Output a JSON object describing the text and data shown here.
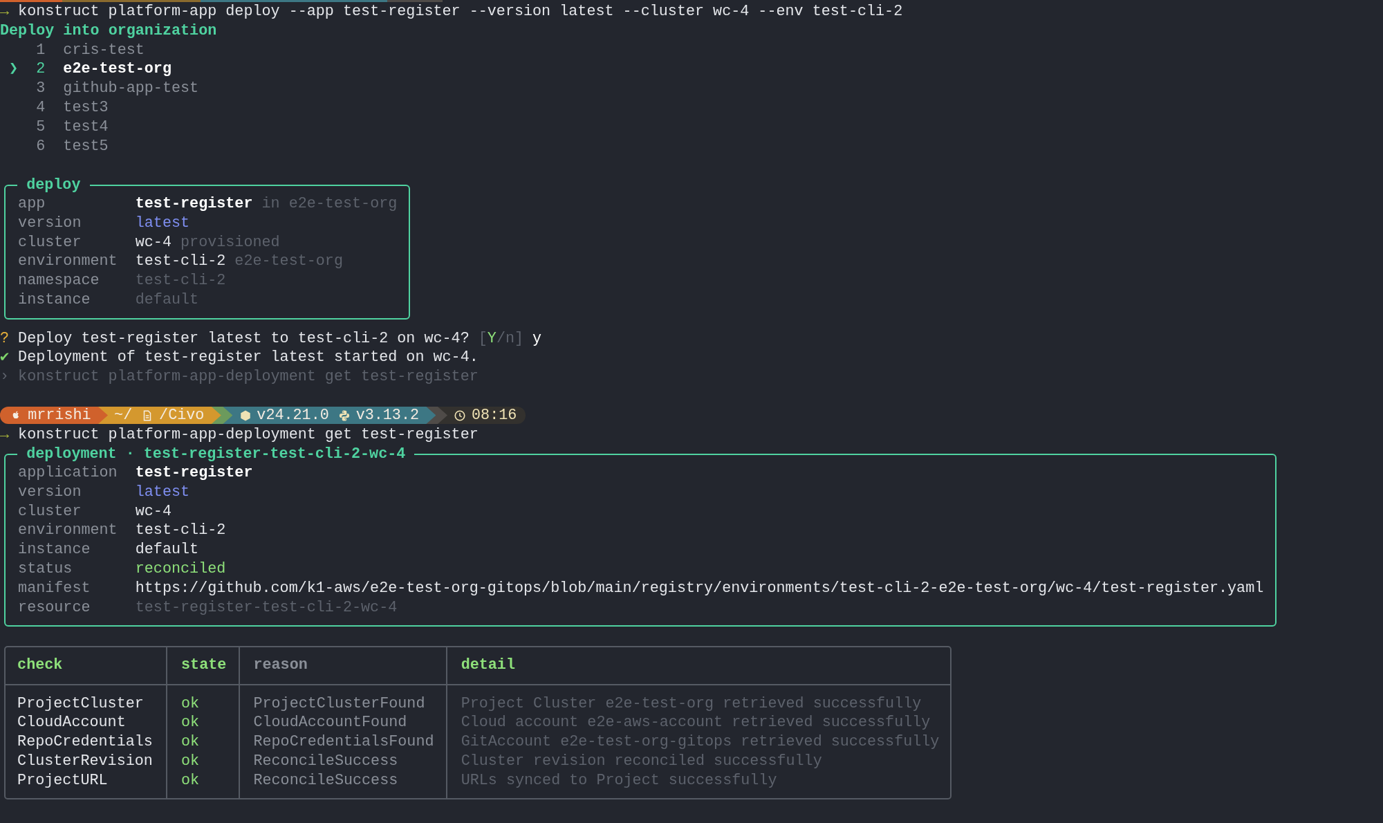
{
  "command_1": {
    "prompt_symbol": "→",
    "text": "konstruct platform-app deploy --app test-register --version latest --cluster wc-4 --env test-cli-2"
  },
  "org_picker": {
    "title": "Deploy into organization",
    "cursor": "❯",
    "options": [
      {
        "number": "1",
        "name": "cris-test",
        "selected": false
      },
      {
        "number": "2",
        "name": "e2e-test-org",
        "selected": true
      },
      {
        "number": "3",
        "name": "github-app-test",
        "selected": false
      },
      {
        "number": "4",
        "name": "test3",
        "selected": false
      },
      {
        "number": "5",
        "name": "test4",
        "selected": false
      },
      {
        "number": "6",
        "name": "test5",
        "selected": false
      }
    ]
  },
  "deploy_box": {
    "title": "deploy",
    "fields": [
      {
        "label": "app",
        "value": "test-register",
        "kind": "bold",
        "note": "in e2e-test-org"
      },
      {
        "label": "version",
        "value": "latest",
        "kind": "accent"
      },
      {
        "label": "cluster",
        "value": "wc-4",
        "kind": "plain",
        "note": "provisioned"
      },
      {
        "label": "environment",
        "value": "test-cli-2",
        "kind": "plain",
        "note": "e2e-test-org"
      },
      {
        "label": "namespace",
        "value": "test-cli-2",
        "kind": "muted"
      },
      {
        "label": "instance",
        "value": "default",
        "kind": "muted"
      }
    ]
  },
  "confirm": {
    "symbol": "?",
    "question": "Deploy test-register latest to test-cli-2 on wc-4?",
    "choices": {
      "open": "[",
      "default": "Y",
      "separator": "/",
      "other": "n",
      "close": "]"
    },
    "answer": "y"
  },
  "result": {
    "symbol": "✔",
    "text": "Deployment of test-register latest started on wc-4."
  },
  "suggestion": {
    "symbol": "›",
    "text": "konstruct platform-app-deployment get test-register"
  },
  "prompt_bar": {
    "segments": [
      {
        "color": "#d0612c",
        "items": [
          {
            "kind": "user",
            "text": "mrrishi"
          }
        ]
      },
      {
        "color": "#d4982e",
        "items": [
          {
            "kind": "home",
            "text": "~/"
          },
          {
            "kind": "folder",
            "text": "/Civo"
          }
        ]
      },
      {
        "color": "#6c9a5c"
      },
      {
        "color": "#3d7784",
        "items": [
          {
            "kind": "node",
            "text": "v24.21.0"
          },
          {
            "kind": "python",
            "text": "v3.13.2"
          }
        ]
      },
      {
        "color": "#4f4b48"
      },
      {
        "color": "#33312e",
        "items": [
          {
            "kind": "time",
            "text": "08:16"
          }
        ]
      }
    ]
  },
  "command_2": {
    "prompt_symbol": "→",
    "text": "konstruct platform-app-deployment get test-register"
  },
  "deployment_box": {
    "title": "deployment · test-register-test-cli-2-wc-4",
    "fields": [
      {
        "label": "application",
        "value": "test-register",
        "kind": "bold"
      },
      {
        "label": "version",
        "value": "latest",
        "kind": "accent"
      },
      {
        "label": "cluster",
        "value": "wc-4",
        "kind": "plain"
      },
      {
        "label": "environment",
        "value": "test-cli-2",
        "kind": "plain"
      },
      {
        "label": "instance",
        "value": "default",
        "kind": "plain"
      },
      {
        "label": "status",
        "value": "reconciled",
        "kind": "success"
      },
      {
        "label": "manifest",
        "value": "https://github.com/k1-aws/e2e-test-org-gitops/blob/main/registry/environments/test-cli-2-e2e-test-org/wc-4/test-register.yaml",
        "kind": "plain"
      },
      {
        "label": "resource",
        "value": "test-register-test-cli-2-wc-4",
        "kind": "muted"
      }
    ]
  },
  "checks_table": {
    "columns": [
      "check",
      "state",
      "reason",
      "detail"
    ],
    "rows": [
      [
        "ProjectCluster",
        "ok",
        "ProjectClusterFound",
        "Project Cluster e2e-test-org retrieved successfully"
      ],
      [
        "CloudAccount",
        "ok",
        "CloudAccountFound",
        "Cloud account e2e-aws-account retrieved successfully"
      ],
      [
        "RepoCredentials",
        "ok",
        "RepoCredentialsFound",
        "GitAccount e2e-test-org-gitops retrieved successfully"
      ],
      [
        "ClusterRevision",
        "ok",
        "ReconcileSuccess",
        "Cluster revision reconciled successfully"
      ],
      [
        "ProjectURL",
        "ok",
        "ReconcileSuccess",
        "URLs synced to Project successfully"
      ]
    ]
  }
}
